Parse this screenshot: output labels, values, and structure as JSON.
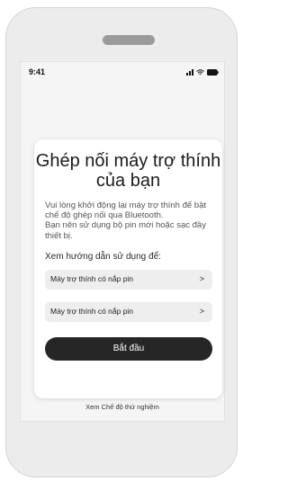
{
  "status": {
    "time": "9:41"
  },
  "card": {
    "title": "Ghép nối máy trợ thính của bạn",
    "description_lines": [
      "Vui lòng khởi động lại máy trợ thính để bật chế độ ghép nối qua Bluetooth.",
      "Bạn nên sử dụng bộ pin mới hoặc sạc đầy thiết bị."
    ],
    "guide_label": "Xem hướng dẫn sử dụng để:",
    "options": [
      {
        "label": "Máy trợ thính có nắp pin",
        "chevron": ">"
      },
      {
        "label": "Máy trợ thính có nắp pin",
        "chevron": ">"
      }
    ],
    "start_button": "Bắt đầu"
  },
  "footer_link": "Xem Chế độ thử nghiệm",
  "colors": {
    "button": "#262626",
    "card": "#ffffff",
    "option_bg": "#eeeeee"
  }
}
